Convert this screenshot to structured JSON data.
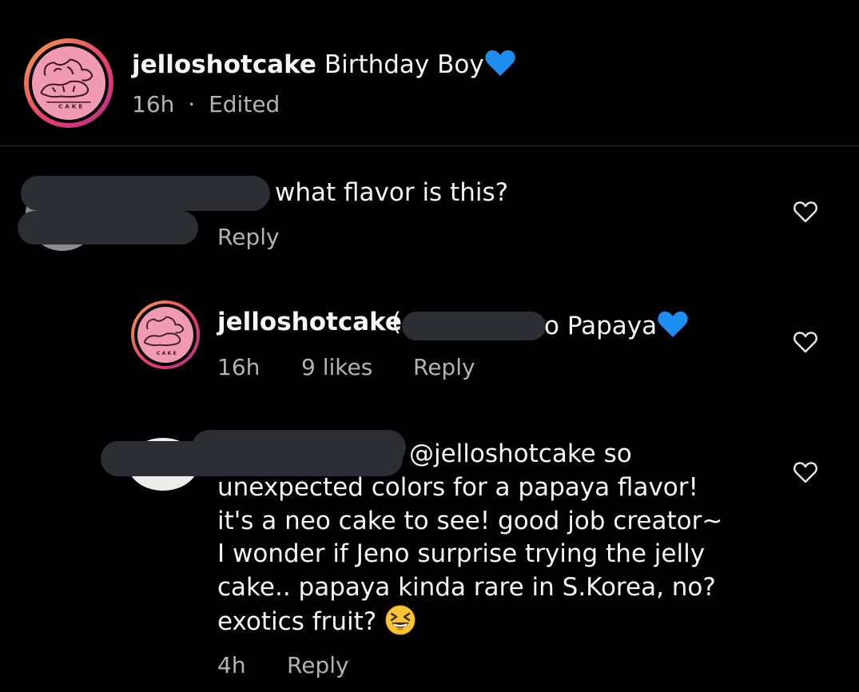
{
  "caption": {
    "username": "jelloshotcake",
    "text": "Birthday Boy",
    "time": "16h",
    "separator": "·",
    "edited": "Edited"
  },
  "comments": [
    {
      "text": "what flavor is this?",
      "reply_label": "Reply"
    },
    {
      "username": "jelloshotcake",
      "text_visible": "o Papaya",
      "time": "16h",
      "likes": "9 likes",
      "reply_label": "Reply"
    },
    {
      "mention": "@jelloshotcake",
      "lines": [
        "so",
        "unexpected colors for a papaya flavor!",
        "it's a neo cake to see! good job creator~",
        "I wonder if Jeno surprise trying the jelly",
        "cake.. papaya kinda rare in S.Korea, no?",
        "exotics fruit?"
      ],
      "time": "4h",
      "reply_label": "Reply"
    }
  ],
  "icons": {
    "like": "heart-outline-icon",
    "emoji_heart": "blue-heart-emoji",
    "emoji_laugh": "grinning-squinting-face-emoji"
  },
  "colors": {
    "background": "#000000",
    "text": "#f5f5f5",
    "secondary": "#b3b3b3",
    "redaction": "#2b2e33",
    "blue_heart": "#1d8ef0",
    "avatar_pink": "#f19ab4"
  }
}
